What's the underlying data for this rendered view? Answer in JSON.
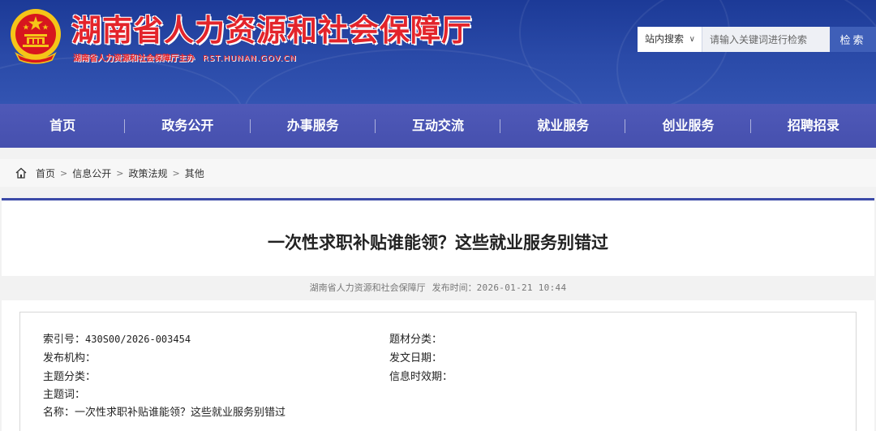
{
  "header": {
    "site_title": "湖南省人力资源和社会保障厅",
    "site_subtitle": "湖南省人力资源和社会保障厅主办",
    "site_domain": "RST.HUNAN.GOV.CN",
    "emblem_icon": "national-emblem-icon",
    "title_color": "#e3242b",
    "banner_color": "#1c3a97"
  },
  "search": {
    "scope_label": "站内搜索",
    "placeholder": "请输入关键词进行检索",
    "button_label": "检索"
  },
  "nav": {
    "items": [
      "首页",
      "政务公开",
      "办事服务",
      "互动交流",
      "就业服务",
      "创业服务",
      "招聘招录"
    ],
    "color": "#4f59b8"
  },
  "breadcrumb": {
    "items": [
      "首页",
      "信息公开",
      "政策法规",
      "其他"
    ]
  },
  "article": {
    "title": "一次性求职补贴谁能领？这些就业服务别错过",
    "source": "湖南省人力资源和社会保障厅",
    "pubtime_label": "发布时间：",
    "pubtime": "2026-01-21 10:44"
  },
  "info": {
    "index_label": "索引号：",
    "index_value": "430S00/2026-003454",
    "category_label": "题材分类：",
    "category_value": "",
    "publisher_label": "发布机构：",
    "publisher_value": "",
    "issue_date_label": "发文日期：",
    "issue_date_value": "",
    "topic_label": "主题分类：",
    "topic_value": "",
    "validity_label": "信息时效期：",
    "validity_value": "",
    "keywords_label": "主题词：",
    "keywords_value": "",
    "name_label": "名称：",
    "name_value": "一次性求职补贴谁能领？这些就业服务别错过"
  }
}
